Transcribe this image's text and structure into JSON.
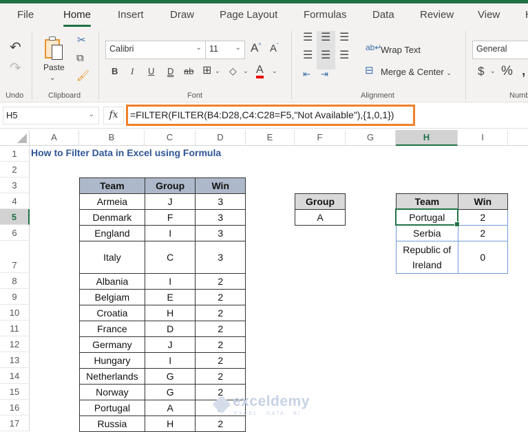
{
  "tabs": [
    {
      "label": "File",
      "active": false
    },
    {
      "label": "Home",
      "active": true
    },
    {
      "label": "Insert",
      "active": false
    },
    {
      "label": "Draw",
      "active": false
    },
    {
      "label": "Page Layout",
      "active": false
    },
    {
      "label": "Formulas",
      "active": false
    },
    {
      "label": "Data",
      "active": false
    },
    {
      "label": "Review",
      "active": false
    },
    {
      "label": "View",
      "active": false
    },
    {
      "label": "H",
      "active": false
    }
  ],
  "ribbon": {
    "undo_group": "Undo",
    "clipboard_group": "Clipboard",
    "paste_label": "Paste",
    "font_group": "Font",
    "font_name": "Calibri",
    "font_size": "11",
    "bold": "B",
    "italic": "I",
    "underline": "U",
    "double_underline": "D",
    "strikethrough": "ab",
    "grow_font": "A",
    "shrink_font": "A",
    "font_color": "A",
    "alignment_group": "Alignment",
    "wrap_text": "Wrap Text",
    "merge_center": "Merge & Center",
    "number_format": "General",
    "currency": "$",
    "percent": "%",
    "number_group": "Numb"
  },
  "formula_bar": {
    "name_box": "H5",
    "fx": "fx",
    "formula": "=FILTER(FILTER(B4:D28,C4:C28=F5,\"Not Available\"),{1,0,1})"
  },
  "columns": [
    "A",
    "B",
    "C",
    "D",
    "E",
    "F",
    "G",
    "H",
    "I"
  ],
  "selected_column": "H",
  "rows": [
    "1",
    "2",
    "3",
    "4",
    "5",
    "6",
    "7",
    "8",
    "9",
    "10",
    "11",
    "12",
    "13",
    "14",
    "15",
    "16",
    "17"
  ],
  "selected_row": "5",
  "sheet_title": "How to Filter Data in Excel using Formula",
  "main_table": {
    "headers": [
      "Team",
      "Group",
      "Win"
    ],
    "rows": [
      [
        "Armeia",
        "J",
        "3"
      ],
      [
        "Denmark",
        "F",
        "3"
      ],
      [
        "England",
        "I",
        "3"
      ],
      [
        "Italy",
        "C",
        "3"
      ],
      [
        "Albania",
        "I",
        "2"
      ],
      [
        "Belgiam",
        "E",
        "2"
      ],
      [
        "Croatia",
        "H",
        "2"
      ],
      [
        "France",
        "D",
        "2"
      ],
      [
        "Germany",
        "J",
        "2"
      ],
      [
        "Hungary",
        "I",
        "2"
      ],
      [
        "Netherlands",
        "G",
        "2"
      ],
      [
        "Norway",
        "G",
        "2"
      ],
      [
        "Portugal",
        "A",
        "2"
      ],
      [
        "Russia",
        "H",
        "2"
      ]
    ]
  },
  "criteria_table": {
    "header": "Group",
    "value": "A"
  },
  "result_table": {
    "headers": [
      "Team",
      "Win"
    ],
    "rows": [
      [
        "Portugal",
        "2"
      ],
      [
        "Serbia",
        "2"
      ],
      [
        "Republic of Ireland",
        "0"
      ]
    ]
  },
  "watermark": {
    "brand": "exceldemy",
    "tagline": "EXCEL · DATA · BI"
  },
  "colors": {
    "excel_green": "#1e7145",
    "formula_highlight": "#f0802a",
    "title_blue": "#2f5597",
    "table_header": "#adb9ca"
  }
}
